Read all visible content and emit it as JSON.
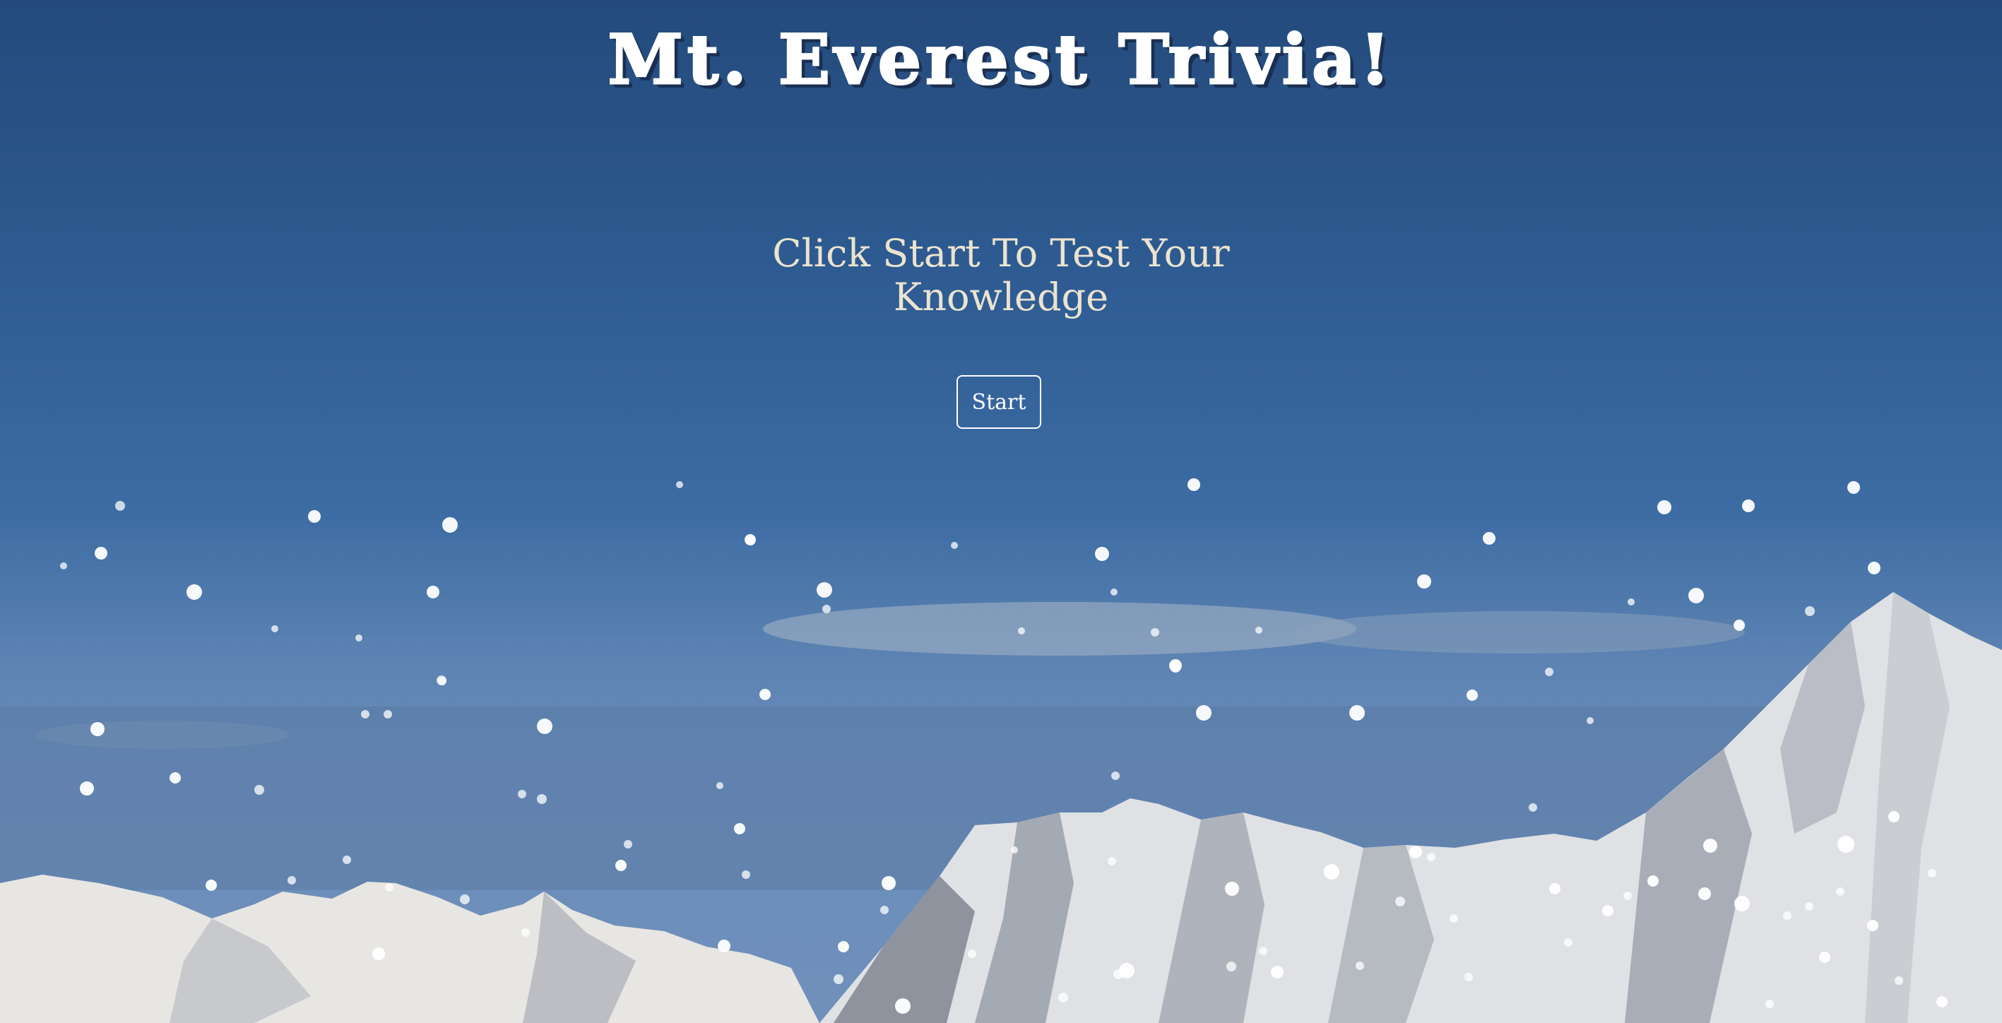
{
  "page": {
    "title": "Mt. Everest Trivia!",
    "prompt": "Click Start To Test Your Knowledge",
    "start_label": "Start"
  },
  "colors": {
    "sky_top": "#244a7c",
    "sky_mid": "#3d6ca3",
    "title_text": "#ffffff",
    "prompt_text": "#ece3cf",
    "button_border": "#ffffff",
    "snow": "#ffffff"
  },
  "background": {
    "scene": "mountain-range",
    "effect": "falling-snow"
  }
}
